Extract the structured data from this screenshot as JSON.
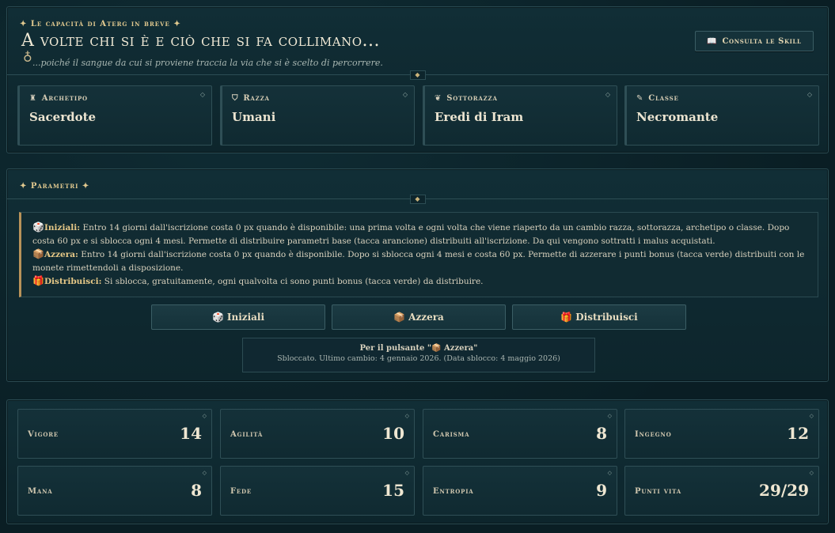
{
  "header": {
    "kicker": "✦ Le capacità di Aterg in breve ✦",
    "title": "A volte chi si è e ciò che si fa collimano...",
    "subtitle": "...poiché il sangue da cui si proviene traccia la via che si è scelto di percorrere.",
    "skill_button_icon": "book-icon",
    "skill_button_label": "Consulta le Skill",
    "divider_glyph": "◆"
  },
  "identity": [
    {
      "label": "Archetipo",
      "value": "Sacerdote",
      "icon": "chess-rook-icon",
      "glyph": "♜"
    },
    {
      "label": "Razza",
      "value": "Umani",
      "icon": "shield-icon",
      "glyph": "⛉"
    },
    {
      "label": "Sottorazza",
      "value": "Eredi di Iram",
      "icon": "leaf-icon",
      "glyph": "❦"
    },
    {
      "label": "Classe",
      "value": "Necromante",
      "icon": "scroll-icon",
      "glyph": "✎"
    }
  ],
  "corner_glyph": "◇",
  "parametri": {
    "kicker": "✦ Parametri ✦",
    "info": [
      {
        "icon": "🎲",
        "label": "Iniziali:",
        "text": " Entro 14 giorni dall'iscrizione costa 0 px quando è disponibile: una prima volta e ogni volta che viene riaperto da un cambio razza, sottorazza, archetipo o classe. Dopo costa 60 px e si sblocca ogni 4 mesi. Permette di distribuire parametri base (tacca arancione) distribuiti all'iscrizione. Da qui vengono sottratti i malus acquistati."
      },
      {
        "icon": "📦",
        "label": "Azzera:",
        "text": " Entro 14 giorni dall'iscrizione costa 0 px quando è disponibile. Dopo si sblocca ogni 4 mesi e costa 60 px. Permette di azzerare i punti bonus (tacca verde) distribuiti con le monete rimettendoli a disposizione."
      },
      {
        "icon": "🎁",
        "label": "Distribuisci:",
        "text": " Si sblocca, gratuitamente, ogni qualvolta ci sono punti bonus (tacca verde) da distribuire."
      }
    ],
    "buttons": [
      {
        "icon": "🎲",
        "label": "Iniziali"
      },
      {
        "icon": "📦",
        "label": "Azzera"
      },
      {
        "icon": "🎁",
        "label": "Distribuisci"
      }
    ],
    "note_title": "Per il pulsante \"📦 Azzera\"",
    "note_sub": "Sbloccato. Ultimo cambio: 4 gennaio 2026. (Data sblocco: 4 maggio 2026)"
  },
  "stats": [
    {
      "label": "Vigore",
      "value": "14"
    },
    {
      "label": "Agilità",
      "value": "10"
    },
    {
      "label": "Carisma",
      "value": "8"
    },
    {
      "label": "Ingegno",
      "value": "12"
    },
    {
      "label": "Mana",
      "value": "8"
    },
    {
      "label": "Fede",
      "value": "15"
    },
    {
      "label": "Entropia",
      "value": "9"
    },
    {
      "label": "Punti vita",
      "value": "29/29"
    }
  ]
}
